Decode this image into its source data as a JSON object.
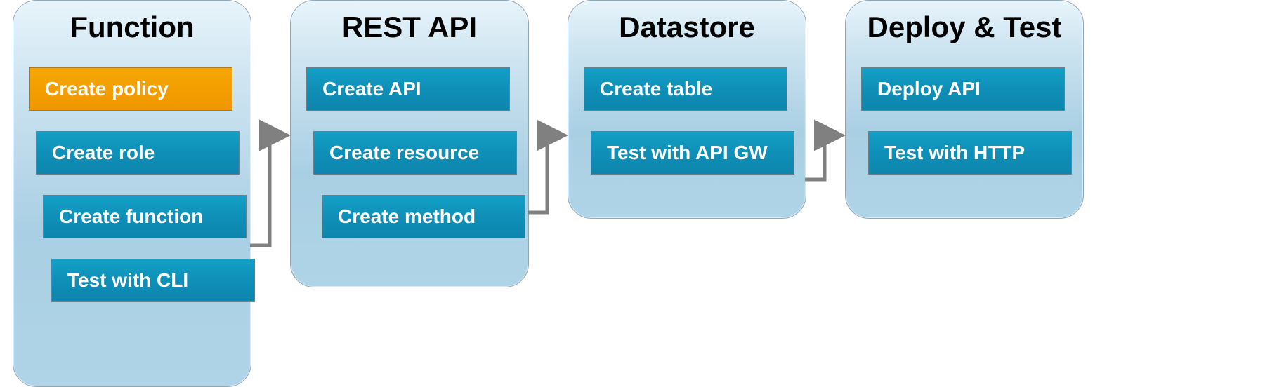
{
  "stages": [
    {
      "title": "Function",
      "steps": [
        {
          "label": "Create policy",
          "highlight": true
        },
        {
          "label": "Create role",
          "highlight": false
        },
        {
          "label": "Create function",
          "highlight": false
        },
        {
          "label": "Test with CLI",
          "highlight": false
        }
      ]
    },
    {
      "title": "REST API",
      "steps": [
        {
          "label": "Create API",
          "highlight": false
        },
        {
          "label": "Create resource",
          "highlight": false
        },
        {
          "label": "Create method",
          "highlight": false
        }
      ]
    },
    {
      "title": "Datastore",
      "steps": [
        {
          "label": "Create table",
          "highlight": false
        },
        {
          "label": "Test with API GW",
          "highlight": false
        }
      ]
    },
    {
      "title": "Deploy & Test",
      "steps": [
        {
          "label": "Deploy API",
          "highlight": false
        },
        {
          "label": "Test with HTTP",
          "highlight": false
        }
      ]
    }
  ]
}
